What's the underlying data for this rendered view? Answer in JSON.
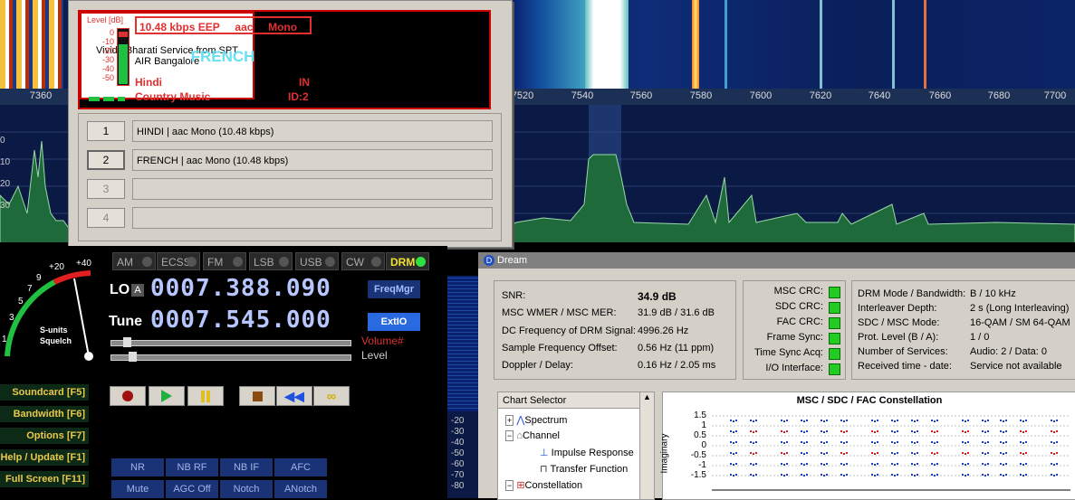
{
  "frequency_axis": {
    "ticks": [
      "7360",
      "7520",
      "7540",
      "7560",
      "7580",
      "7600",
      "7620",
      "7640",
      "7660",
      "7680",
      "7700"
    ]
  },
  "spectrum_scale": [
    "0",
    "10",
    "20",
    "30"
  ],
  "drm_popup": {
    "level_label": "Level [dB]",
    "level_scale": [
      "0",
      "-10",
      "-20",
      "-30",
      "-40",
      "-50"
    ],
    "bitrate": "10.48 kbps EEP",
    "codec": "aac",
    "audio_mode": "Mono",
    "service_label": "FRENCH",
    "language": "Hindi",
    "country": "IN",
    "program_type": "Country Music",
    "service_id": "ID:2",
    "text_message": "Vividh Bharati Service from SPT AIR Bangalore",
    "services": [
      {
        "number": "1",
        "label": "HINDI  |   aac Mono (10.48 kbps)"
      },
      {
        "number": "2",
        "label": "FRENCH  |   aac Mono (10.48 kbps)"
      },
      {
        "number": "3",
        "label": ""
      },
      {
        "number": "4",
        "label": ""
      }
    ]
  },
  "radio": {
    "modes": [
      {
        "label": "AM",
        "active": false
      },
      {
        "label": "ECSS",
        "active": false
      },
      {
        "label": "FM",
        "active": false
      },
      {
        "label": "LSB",
        "active": false
      },
      {
        "label": "USB",
        "active": false
      },
      {
        "label": "CW",
        "active": false
      },
      {
        "label": "DRM",
        "active": true
      }
    ],
    "lo_label": "LO",
    "lo_a": "A",
    "lo_freq": "0007.388.090",
    "tune_label": "Tune",
    "tune_freq": "0007.545.000",
    "freqmgr": "FreqMgr",
    "extio": "ExtIO",
    "volume_label": "Volume#",
    "level_label": "Level",
    "s_meter_scale": [
      "1",
      "3",
      "5",
      "7",
      "9",
      "+20",
      "+40"
    ],
    "s_meter_label1": "S-units",
    "s_meter_label2": "Squelch",
    "side_buttons": [
      "Soundcard [F5]",
      "Bandwidth [F6]",
      "Options  [F7]",
      "Help / Update [F1]",
      "Full Screen [F11]"
    ],
    "bottom_buttons": [
      "NR",
      "NB RF",
      "NB IF",
      "AFC",
      "Mute",
      "AGC Off",
      "Notch",
      "ANotch"
    ]
  },
  "dream": {
    "title": "Dream",
    "status": [
      {
        "label": "SNR:",
        "value": "34.9 dB"
      },
      {
        "label": "MSC WMER / MSC MER:",
        "value": "31.9 dB / 31.6 dB"
      },
      {
        "label": "DC Frequency of DRM Signal:",
        "value": "4996.26 Hz"
      },
      {
        "label": "Sample Frequency Offset:",
        "value": "0.56 Hz (11 ppm)"
      },
      {
        "label": "Doppler / Delay:",
        "value": "0.16 Hz / 2.05 ms"
      }
    ],
    "crc": [
      "MSC CRC:",
      "SDC CRC:",
      "FAC CRC:",
      "Frame Sync:",
      "Time Sync Acq:",
      "I/O Interface:"
    ],
    "params": [
      {
        "label": "DRM Mode / Bandwidth:",
        "value": "B / 10 kHz"
      },
      {
        "label": "Interleaver Depth:",
        "value": "2 s (Long Interleaving)"
      },
      {
        "label": "SDC / MSC Mode:",
        "value": "16-QAM / SM 64-QAM"
      },
      {
        "label": "Prot. Level (B / A):",
        "value": "1 / 0"
      },
      {
        "label": "Number of Services:",
        "value": "Audio: 2 / Data: 0"
      },
      {
        "label": "Received time - date:",
        "value": "Service not available"
      }
    ],
    "chart_selector_title": "Chart Selector",
    "tree": [
      "Spectrum",
      "Channel",
      "Impulse Response",
      "Transfer Function",
      "Constellation"
    ],
    "constellation_title": "MSC / SDC / FAC Constellation",
    "constellation_ylabel": "Imaginary",
    "constellation_yticks": [
      "1.5",
      "1",
      "0.5",
      "0",
      "-0.5",
      "-1",
      "-1.5"
    ],
    "left_scale": [
      "-20",
      "-30",
      "-40",
      "-50",
      "-60",
      "-70",
      "-80"
    ]
  }
}
